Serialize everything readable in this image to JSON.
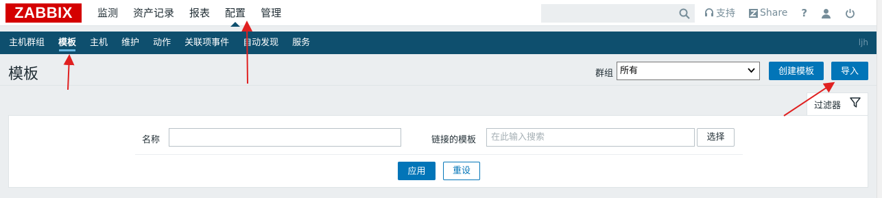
{
  "brand": {
    "logo_text": "ZABBIX",
    "logo_color": "#d40000"
  },
  "top_nav": [
    {
      "label": "监测"
    },
    {
      "label": "资产记录"
    },
    {
      "label": "报表"
    },
    {
      "label": "配置",
      "active": true
    },
    {
      "label": "管理"
    }
  ],
  "top_right": {
    "search_placeholder": "",
    "support_label": "支持",
    "share_label": "Share",
    "help_label": "?"
  },
  "sub_nav": [
    {
      "label": "主机群组"
    },
    {
      "label": "模板",
      "active": true
    },
    {
      "label": "主机"
    },
    {
      "label": "维护"
    },
    {
      "label": "动作"
    },
    {
      "label": "关联项事件"
    },
    {
      "label": "自动发现"
    },
    {
      "label": "服务"
    }
  ],
  "user": {
    "name": "ljh"
  },
  "header": {
    "title": "模板",
    "group_label": "群组",
    "group_value": "所有",
    "create_button": "创建模板",
    "import_button": "导入"
  },
  "filter": {
    "tab_label": "过滤器",
    "name_label": "名称",
    "name_value": "",
    "linked_label": "链接的模板",
    "linked_placeholder": "在此输入搜索",
    "select_button": "选择",
    "apply_button": "应用",
    "reset_button": "重设"
  },
  "colors": {
    "accent": "#0275b8",
    "nav_bg": "#0e4f6e",
    "annotation": "#e02020"
  }
}
